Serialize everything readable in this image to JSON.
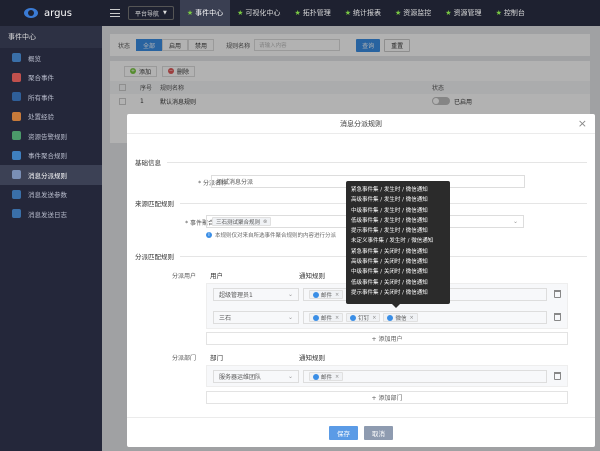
{
  "app": {
    "name": "argus"
  },
  "topbar": {
    "platform_select": "平台导航",
    "nav": [
      {
        "label": "事件中心",
        "active": true
      },
      {
        "label": "可视化中心",
        "active": false
      },
      {
        "label": "拓扑管理",
        "active": false
      },
      {
        "label": "统计报表",
        "active": false
      },
      {
        "label": "资源监控",
        "active": false
      },
      {
        "label": "资源管理",
        "active": false
      },
      {
        "label": "控制台",
        "active": false
      }
    ]
  },
  "sidebar": {
    "header": "事件中心",
    "items": [
      {
        "label": "概览",
        "icon": "overview-icon",
        "active": false
      },
      {
        "label": "聚合事件",
        "icon": "aggregate-icon",
        "active": false
      },
      {
        "label": "所有事件",
        "icon": "events-icon",
        "active": false
      },
      {
        "label": "处置经验",
        "icon": "experience-icon",
        "active": false
      },
      {
        "label": "资源告警规则",
        "icon": "alarm-rule-icon",
        "active": false
      },
      {
        "label": "事件聚合规则",
        "icon": "aggregate-rule-icon",
        "active": false
      },
      {
        "label": "消息分派规则",
        "icon": "dispatch-rule-icon",
        "active": true
      },
      {
        "label": "消息发送参数",
        "icon": "send-param-icon",
        "active": false
      },
      {
        "label": "消息发送日志",
        "icon": "send-log-icon",
        "active": false
      }
    ]
  },
  "filter": {
    "status_label": "状态",
    "status_options": [
      "全部",
      "启用",
      "禁用"
    ],
    "status_selected": "全部",
    "name_label": "规则名称",
    "name_placeholder": "请输入内容",
    "query": "查询",
    "reset": "重置"
  },
  "list": {
    "add": "添加",
    "delete": "删除",
    "columns": {
      "no": "序号",
      "name": "规则名称",
      "status": "状态"
    },
    "rows": [
      {
        "no": "1",
        "name": "默认消息规则",
        "status": "已启用"
      }
    ]
  },
  "modal": {
    "title": "消息分派规则",
    "basic_section": "基础信息",
    "name_label": "* 分派名称",
    "name_value": "测试消息分派",
    "source_section": "来源匹配规则",
    "aggregate_label": "* 事件聚合规则",
    "aggregate_tag": "三石测试聚合规则",
    "hint": "本规则仅对来自所选事件聚合规则的内容进行分派",
    "dispatch_section": "分派匹配规则",
    "user_label": "分派用户",
    "user_col": "用户",
    "notify_col": "通知规则",
    "users": [
      {
        "name": "超级管理员1",
        "tags": [
          "邮件"
        ]
      },
      {
        "name": "三石",
        "tags": [
          "邮件",
          "钉钉",
          "微信"
        ]
      }
    ],
    "add_user": "+ 添加用户",
    "dept_label": "分派部门",
    "dept_col": "部门",
    "dept_notify_col": "通知规则",
    "depts": [
      {
        "name": "服务器运维团队",
        "tags": [
          "邮件"
        ]
      }
    ],
    "add_dept": "+ 添加部门",
    "save": "保存",
    "cancel": "取消"
  },
  "tooltip": {
    "lines": [
      "紧急事件集 / 发生时 / 微信通知",
      "高级事件集 / 发生时 / 微信通知",
      "中级事件集 / 发生时 / 微信通知",
      "低级事件集 / 发生时 / 微信通知",
      "提示事件集 / 发生时 / 微信通知",
      "未定义事件集 / 发生时 / 微信通知",
      "紧急事件集 / 关闭时 / 微信通知",
      "高级事件集 / 关闭时 / 微信通知",
      "中级事件集 / 关闭时 / 微信通知",
      "低级事件集 / 关闭时 / 微信通知",
      "提示事件集 / 关闭时 / 微信通知"
    ]
  },
  "colors": {
    "primary": "#3a8ee6",
    "topbar": "#1e2130",
    "sidebar": "#24273a",
    "nav_star": "#7ac943"
  }
}
